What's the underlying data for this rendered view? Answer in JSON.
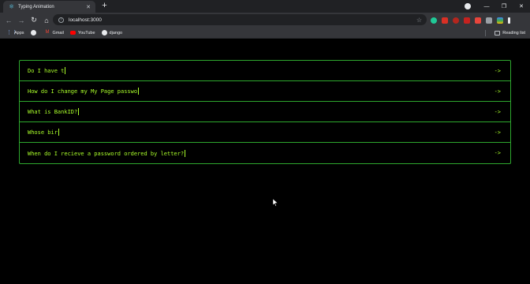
{
  "tab": {
    "title": "Typing Animation"
  },
  "toolbar": {
    "url": "localhost:3000"
  },
  "bookmarks": [
    {
      "label": "Apps",
      "icon": "apps-grid-icon"
    },
    {
      "label": "",
      "icon": "globe-icon"
    },
    {
      "label": "Gmail",
      "icon": "gmail-icon"
    },
    {
      "label": "YouTube",
      "icon": "youtube-icon"
    },
    {
      "label": "django",
      "icon": "django-icon"
    }
  ],
  "reading_list": "Reading list",
  "faq": {
    "items": [
      {
        "question": "Do I have t",
        "arrow": "->"
      },
      {
        "question": "How do I change my My Page passwo",
        "arrow": "->"
      },
      {
        "question": "What is BankID?",
        "arrow": "->"
      },
      {
        "question": "Whose bir",
        "arrow": "->"
      },
      {
        "question": "When do I recieve a password ordered by letter?",
        "arrow": "->"
      }
    ]
  },
  "colors": {
    "accent_green": "#aaff2a",
    "border_green": "#2ea82e",
    "background": "#000000"
  }
}
